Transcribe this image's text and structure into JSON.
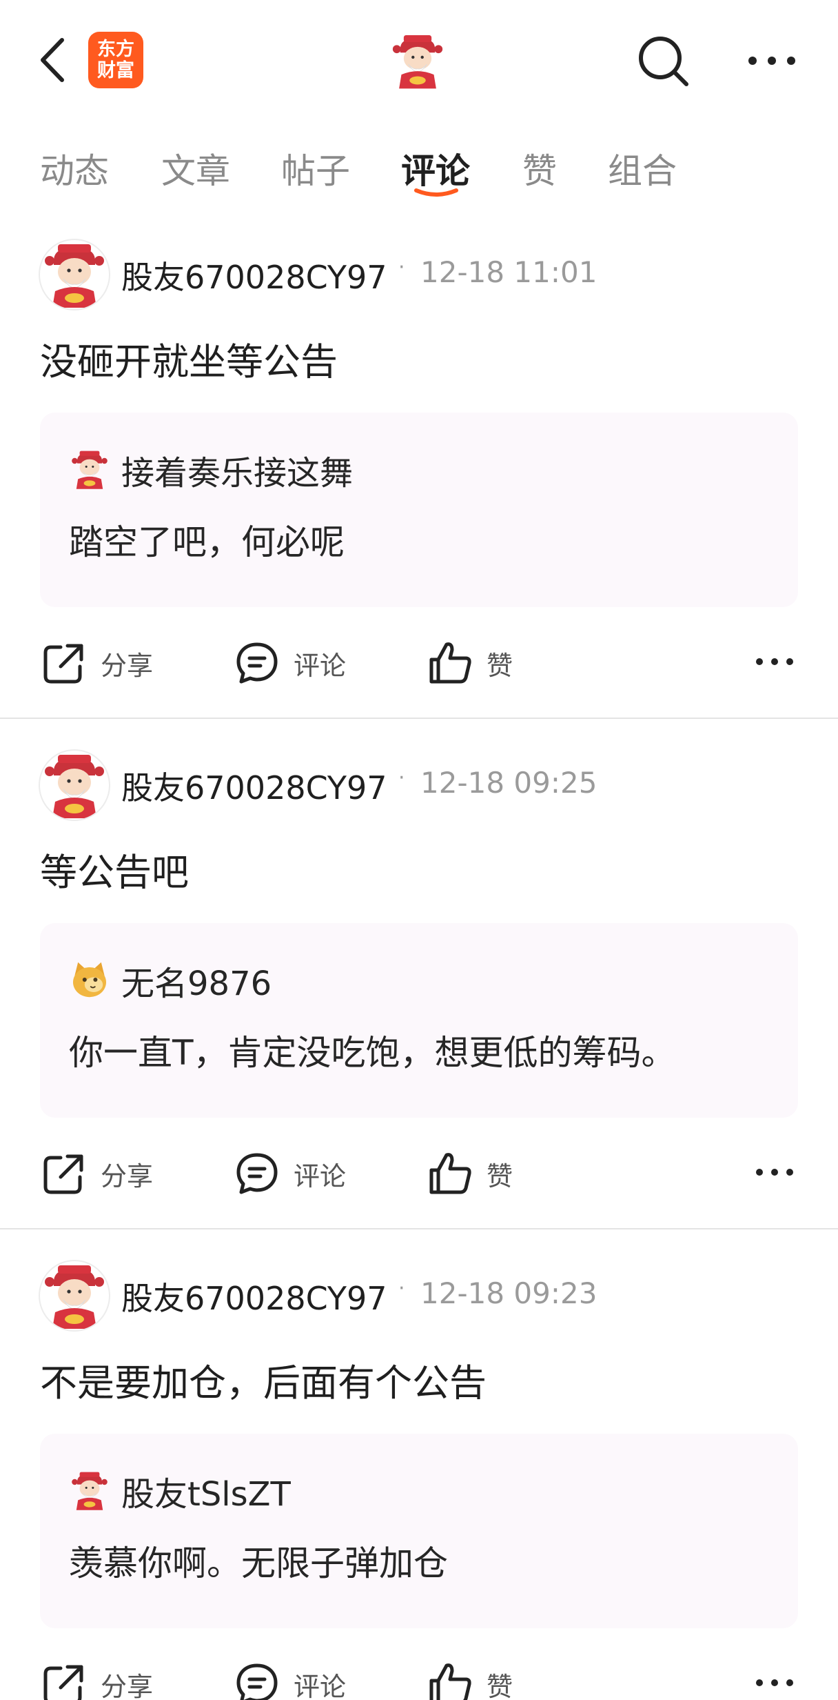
{
  "header": {
    "logo_line1": "东方",
    "logo_line2": "财富",
    "back_icon": "back-arrow-icon",
    "search_icon": "search-icon",
    "more_icon": "more-icon"
  },
  "tabs": [
    {
      "label": "动态",
      "active": false
    },
    {
      "label": "文章",
      "active": false
    },
    {
      "label": "帖子",
      "active": false
    },
    {
      "label": "评论",
      "active": true
    },
    {
      "label": "赞",
      "active": false
    },
    {
      "label": "组合",
      "active": false
    }
  ],
  "actions": {
    "share": "分享",
    "comment": "评论",
    "like": "赞"
  },
  "posts": [
    {
      "username": "股友670028CY97",
      "time": "12-18 11:01",
      "content": "没砸开就坐等公告",
      "quote": {
        "name": "接着奏乐接这舞",
        "text": "踏空了吧，何必呢"
      }
    },
    {
      "username": "股友670028CY97",
      "time": "12-18 09:25",
      "content": "等公告吧",
      "quote": {
        "name": "无名9876",
        "text": "你一直T，肯定没吃饱，想更低的筹码。"
      }
    },
    {
      "username": "股友670028CY97",
      "time": "12-18 09:23",
      "content": "不是要加仓，后面有个公告",
      "quote": {
        "name": "股友tSlsZT",
        "text": "羡慕你啊。无限子弹加仓"
      }
    }
  ],
  "colors": {
    "accent": "#ff5a1f",
    "quote_bg": "#fcf8fc"
  }
}
